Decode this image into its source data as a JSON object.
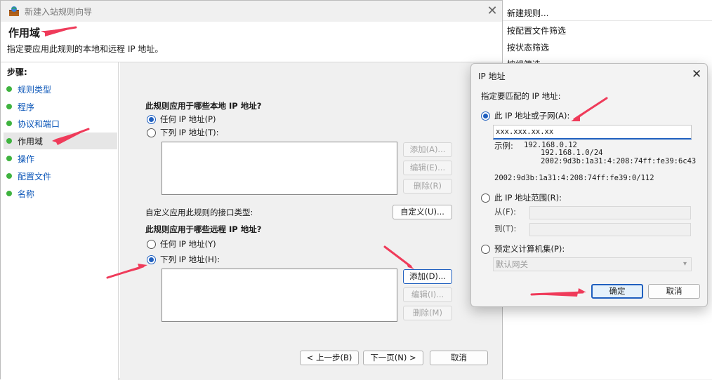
{
  "background_pane": {
    "items": [
      "新建规则...",
      "按配置文件筛选",
      "按状态筛选",
      "按组筛选"
    ]
  },
  "wizard": {
    "title": "新建入站规则向导",
    "header_title": "作用域",
    "header_subtitle": "指定要应用此规则的本地和远程 IP 地址。",
    "steps_label": "步骤:",
    "steps": [
      "规则类型",
      "程序",
      "协议和端口",
      "作用域",
      "操作",
      "配置文件",
      "名称"
    ],
    "local_question": "此规则应用于哪些本地 IP 地址?",
    "local_any": "任何 IP 地址(P)",
    "local_list": "下列 IP 地址(T):",
    "local_buttons": {
      "add": "添加(A)...",
      "edit": "编辑(E)...",
      "remove": "删除(R)"
    },
    "interface_label": "自定义应用此规则的接口类型:",
    "customize_button": "自定义(U)...",
    "remote_question": "此规则应用于哪些远程 IP 地址?",
    "remote_any": "任何 IP 地址(Y)",
    "remote_list": "下列 IP 地址(H):",
    "remote_buttons": {
      "add": "添加(D)...",
      "edit": "编辑(I)...",
      "remove": "删除(M)"
    },
    "nav": {
      "back": "< 上一步(B)",
      "next": "下一页(N) >",
      "cancel": "取消"
    }
  },
  "ip_dialog": {
    "title": "IP 地址",
    "prompt": "指定要匹配的 IP 地址:",
    "option_single": "此 IP 地址或子网(A):",
    "ip_value": "xxx.xxx.xx.xx",
    "example_label": "示例:",
    "examples": [
      "192.168.0.12",
      "192.168.1.0/24",
      "2002:9d3b:1a31:4:208:74ff:fe39:6c43"
    ],
    "example_extra": "2002:9d3b:1a31:4:208:74ff:fe39:0/112",
    "option_range": "此 IP 地址范围(R):",
    "from_label": "从(F):",
    "to_label": "到(T):",
    "option_predefined": "预定义计算机集(P):",
    "predefined_value": "默认网关",
    "ok": "确定",
    "cancel": "取消"
  },
  "colors": {
    "accent": "#1f5fbf",
    "arrow": "#ef3b5a",
    "step_dot": "#3fb33f"
  }
}
